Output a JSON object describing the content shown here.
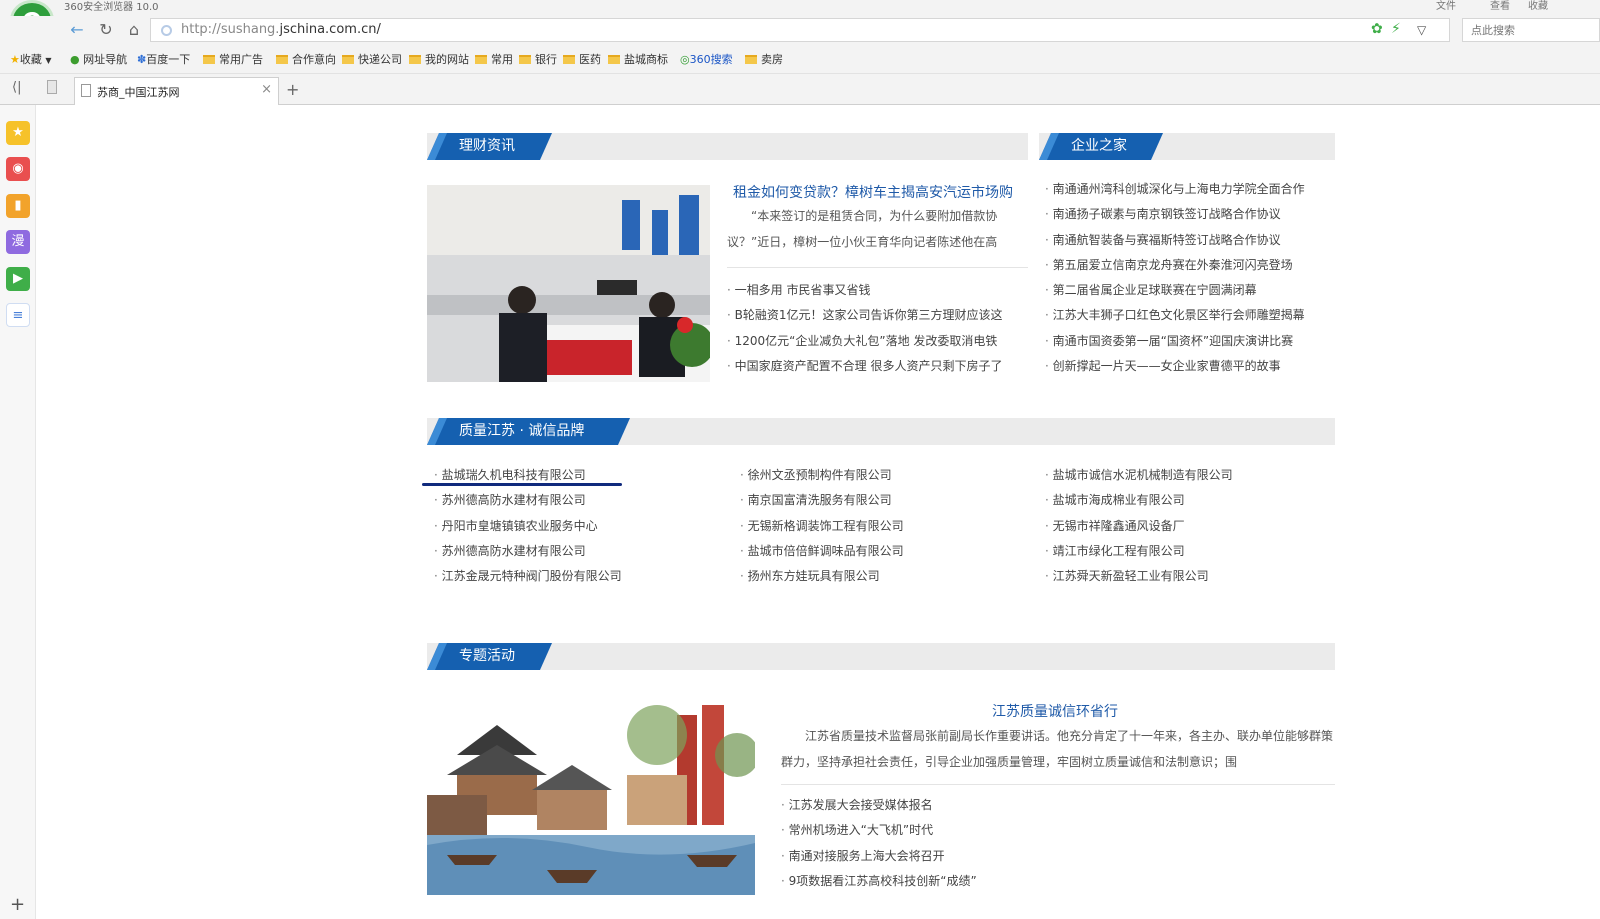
{
  "browser": {
    "title": "360安全浏览器 10.0",
    "window_controls": [
      "文件",
      "查看",
      "收藏"
    ],
    "url_prefix": "http://sushang.",
    "url_host": "jschina.com.cn/",
    "search_placeholder": "点此搜索",
    "bookmarks": [
      {
        "label": "收藏",
        "icon": "star-icon"
      },
      {
        "label": "网址导航",
        "icon": "globe-icon"
      },
      {
        "label": "百度一下",
        "icon": "paw-icon"
      },
      {
        "label": "常用广告",
        "icon": "folder-icon"
      },
      {
        "label": "合作意向",
        "icon": "folder-icon"
      },
      {
        "label": "快递公司",
        "icon": "folder-icon"
      },
      {
        "label": "我的网站",
        "icon": "folder-icon"
      },
      {
        "label": "常用",
        "icon": "folder-icon"
      },
      {
        "label": "银行",
        "icon": "folder-icon"
      },
      {
        "label": "医药",
        "icon": "folder-icon"
      },
      {
        "label": "盐城商标",
        "icon": "folder-icon"
      },
      {
        "label": "360搜索",
        "icon": "360-icon"
      },
      {
        "label": "卖房",
        "icon": "folder-icon"
      }
    ],
    "tab_label": "苏商_中国江苏网",
    "colors": {
      "accent": "#1560b0",
      "chrome": "#f3f3f3",
      "link": "#1f5aa8"
    }
  },
  "sections": {
    "finance": {
      "heading": "理财资讯",
      "featured_title": "租金如何变贷款？樟树车主揭高安汽运市场购",
      "summary": "“本来签订的是租赁合同，为什么要附加借款协议？”近日，樟树一位小伙王育华向记者陈述他在高",
      "items": [
        "一相多用 市民省事又省钱",
        "B轮融资1亿元！这家公司告诉你第三方理财应该这",
        "1200亿元“企业减负大礼包”落地 发改委取消电铁",
        "中国家庭资产配置不合理 很多人资产只剩下房子了"
      ]
    },
    "enterprise": {
      "heading": "企业之家",
      "items": [
        "南通通州湾科创城深化与上海电力学院全面合作",
        "南通扬子碳素与南京钢铁签订战略合作协议",
        "南通航智装备与赛福斯特签订战略合作协议",
        "第五届爱立信南京龙舟赛在外秦淮河闪亮登场",
        "第二届省属企业足球联赛在宁圆满闭幕",
        "江苏大丰狮子口红色文化景区举行会师雕塑揭幕",
        "南通市国资委第一届“国资杯”迎国庆演讲比赛",
        "创新撑起一片天——女企业家曹德平的故事"
      ]
    },
    "quality": {
      "heading": "质量江苏 · 诚信品牌",
      "col1": [
        "盐城瑞久机电科技有限公司",
        "苏州德高防水建材有限公司",
        "丹阳市皇塘镇镇农业服务中心",
        "苏州德高防水建材有限公司",
        "江苏金晟元特种阀门股份有限公司"
      ],
      "col2": [
        "徐州文丞预制构件有限公司",
        "南京国富清洗服务有限公司",
        "无锡新格调装饰工程有限公司",
        "盐城市倍倍鲜调味品有限公司",
        "扬州东方娃玩具有限公司"
      ],
      "col3": [
        "盐城市诚信水泥机械制造有限公司",
        "盐城市海成棉业有限公司",
        "无锡市祥隆鑫通风设备厂",
        "靖江市绿化工程有限公司",
        "江苏舜天新盈轻工业有限公司"
      ]
    },
    "special": {
      "heading": "专题活动",
      "featured_title": "江苏质量诚信环省行",
      "summary": "江苏省质量技术监督局张前副局长作重要讲话。他充分肯定了十一年来，各主办、联办单位能够群策群力，坚持承担社会责任，引导企业加强质量管理，牢固树立质量诚信和法制意识；围",
      "items": [
        "江苏发展大会接受媒体报名",
        "常州机场进入“大飞机”时代",
        "南通对接服务上海大会将召开",
        "9项数据看江苏高校科技创新“成绩”"
      ]
    }
  }
}
